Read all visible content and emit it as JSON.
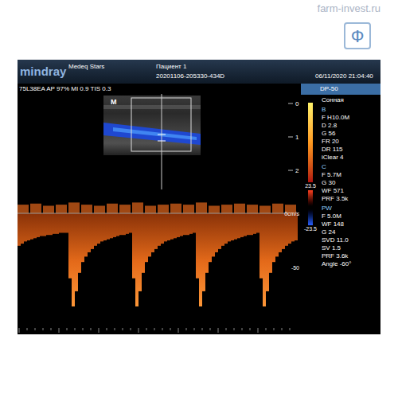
{
  "watermark": "farm-invest.ru",
  "logo": "Ф",
  "header": {
    "brand": "mindray",
    "site": "Medeq Stars",
    "patient": "Пациент 1",
    "exam_id": "20201106-205330-434D",
    "datetime": "06/11/2020 21:04:40"
  },
  "info_line": "75L38EA AP 97% MI 0.9 TIS 0.3",
  "b_image": {
    "marker": "M",
    "depth_labels": [
      "0",
      "1",
      "2"
    ]
  },
  "right_panel": {
    "preset": "DP-50",
    "exam": "Сонная",
    "sections": [
      {
        "name": "B",
        "params": [
          "F H10.0M",
          "D 2.8",
          "G 56",
          "FR 20",
          "DR 115",
          "iClear 4"
        ]
      },
      {
        "name": "C",
        "params": [
          "F 5.7M",
          "G 30",
          "WF 571",
          "PRF 3.5k"
        ]
      },
      {
        "name": "PW",
        "params": [
          "F 5.0M",
          "WF 148",
          "G 24",
          "SVD 11.0",
          "SV 1.5",
          "PRF 3.6k",
          "Angle -60°"
        ]
      }
    ],
    "color_scale": {
      "max": "23.5",
      "min": "-23.5"
    }
  },
  "spectrum": {
    "baseline_label": "0cm/s",
    "tick_labels": [
      "-50"
    ],
    "reverse_velocity": [
      -30,
      -28,
      -26,
      -25,
      -24,
      -23,
      -22,
      -21,
      -21,
      -20,
      -20,
      -19,
      -19,
      -18,
      -18,
      -18,
      -60,
      -86,
      -72,
      -55,
      -45,
      -40,
      -36,
      -33,
      -30,
      -28,
      -26,
      -25,
      -24,
      -23,
      -22,
      -21,
      -20,
      -20,
      -19,
      -18,
      -60,
      -86,
      -72,
      -55,
      -45,
      -40,
      -36,
      -33,
      -30,
      -28,
      -26,
      -25,
      -24,
      -23,
      -22,
      -21,
      -20,
      -20,
      -19,
      -18,
      -60,
      -86,
      -72,
      -55,
      -45,
      -40,
      -36,
      -33,
      -30,
      -28,
      -26,
      -25,
      -24,
      -23,
      -22,
      -21,
      -20,
      -20,
      -19,
      -18,
      -60,
      -86,
      -72,
      -55,
      -45,
      -40,
      -36,
      -33,
      -30,
      -28,
      -26,
      -25
    ],
    "forward_velocity": [
      8,
      9,
      7,
      8,
      10,
      8,
      7,
      9,
      8,
      10,
      7,
      8,
      9,
      8,
      10,
      7,
      8,
      9,
      8,
      7,
      9,
      8
    ]
  }
}
